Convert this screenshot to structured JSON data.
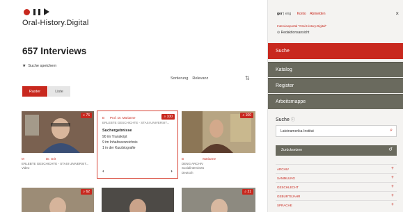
{
  "brand": {
    "name": "Oral-History.Digital"
  },
  "results": {
    "title": "657 Interviews",
    "save_search": "Suche speichern"
  },
  "sort": {
    "label": "Sortierung",
    "value": "Relevanz"
  },
  "view": {
    "grid_label": "Raster",
    "list_label": "Liste"
  },
  "cards": [
    {
      "badge": "76",
      "name": "M",
      "name2": "Dr. Grit",
      "meta1": "ERLEBTE GESCHICHTE - STASI UNIVERSIT...",
      "meta2": "Video"
    },
    {
      "badge": "100",
      "name": "B",
      "name2": "Prof. Dr. Marianne",
      "meta1": "ERLEBTE GESCHICHTE - STASI UNIVERSIT...",
      "heading": "Suchergebnisse",
      "lines": [
        "90 im Transkript",
        "9 im Inhaltsverzeichnis",
        "1 in der Kurzbiografie"
      ]
    },
    {
      "badge": "100",
      "name": "B",
      "name2": "Marianne",
      "meta1": "DENG ARCHIV",
      "meta2": "Sozialinterviews",
      "meta3": "Deutsch"
    },
    {
      "badge": "62"
    },
    {
      "badge": ""
    },
    {
      "badge": "21"
    }
  ],
  "sidebar": {
    "lang": {
      "active": "ger",
      "other": "eng",
      "login": "Konto",
      "logout": "Abmelden"
    },
    "portal": "Interviewportal \"Oral-History.Digital\"",
    "redaction": "Redaktionsansicht",
    "nav": [
      {
        "label": "Suche"
      },
      {
        "label": "Katalog"
      },
      {
        "label": "Register"
      },
      {
        "label": "Arbeitsmappe"
      }
    ],
    "search": {
      "label": "Suche",
      "value": "Lateinamerika-Institut",
      "reset": "Zurücksetzen"
    },
    "facets": [
      "ARCHIV",
      "SAMMLUNG",
      "GESCHLECHT",
      "GEBURTSJAHR",
      "SPRACHE"
    ]
  },
  "colors": {
    "accent": "#c8281e",
    "nav": "#6a6a5e"
  }
}
